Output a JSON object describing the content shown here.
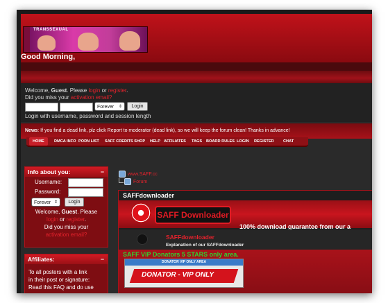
{
  "header": {
    "banner_text": "TRANSSEXUAL",
    "banner_side": "SAFF",
    "greeting": "Good Morning,"
  },
  "login": {
    "welcome_prefix": "Welcome, ",
    "guest": "Guest",
    "please": ". Please ",
    "login_link": "login",
    "or": " or ",
    "register_link": "register",
    "period": ".",
    "missed_prefix": "Did you miss your ",
    "activation_link": "activation email?",
    "duration": "Forever",
    "login_button": "Login",
    "hint": "Login with username, password and session length"
  },
  "news": {
    "label": "News",
    "text": ": If you find a dead link, plz click Report to moderator (dead link), so we will keep the forum clean! Thanks in advance!"
  },
  "nav": [
    "HOME",
    "DMCA INFO",
    "PORN LIST",
    "SAFF CREDITS SHOP",
    "HELP",
    "AFFILIATES",
    "TAGS",
    "BOARD RULES",
    "LOGIN",
    "REGISTER",
    "CHAT"
  ],
  "sidebar": {
    "info_title": "Info about you:",
    "username_label": "Username:",
    "password_label": "Password:",
    "duration": "Forever",
    "login_button": "Login",
    "welcome_prefix": "Welcome, ",
    "guest": "Guest",
    "please": ". Please",
    "login_link": "login",
    "or": " or ",
    "register_link": "register",
    "period": ".",
    "missed": "Did you miss your",
    "activation_link": "activation email?",
    "affiliates_title": "Affiliates:",
    "affiliates_line1": "To all posters with a link",
    "affiliates_line2": "in their post or signature:",
    "affiliates_line3": "Read this FAQ and do use"
  },
  "tree": {
    "site": "www.SAFF.cc",
    "forum": "Forum"
  },
  "downloader_panel": {
    "title": "SAFFdownloader",
    "logo_text": "SAFF Downloader",
    "tagline": "100% download guarantee from our a",
    "board_name": "SAFFdownloader",
    "board_desc": "Explanation of our SAFFdownloader"
  },
  "vip_panel": {
    "title": "SAFF VIP Donators 5 STARS only area.",
    "banner_top": "DONATOR VIP ONLY AREA",
    "banner_main": "DONATOR - VIP ONLY"
  }
}
